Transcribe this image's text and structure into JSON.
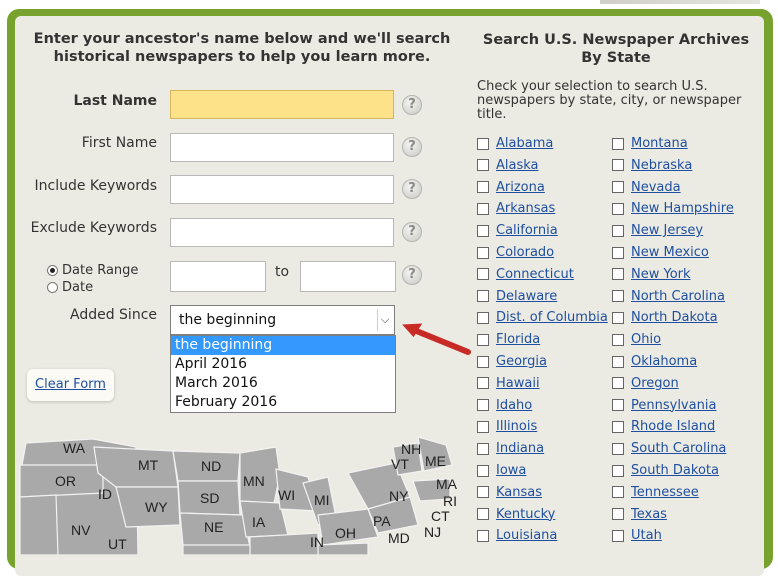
{
  "search_form": {
    "heading": "Enter your ancestor's name below and we'll search historical newspapers to help you learn more.",
    "last_name_label": "Last Name",
    "first_name_label": "First Name",
    "include_keywords_label": "Include Keywords",
    "exclude_keywords_label": "Exclude Keywords",
    "date_range_label": "Date Range",
    "date_label": "Date",
    "to_label": "to",
    "added_since_label": "Added Since",
    "added_since_value": "the beginning",
    "added_since_options": [
      "the beginning",
      "April 2016",
      "March 2016",
      "February 2016"
    ],
    "help_glyph": "?",
    "clear_form": "Clear Form"
  },
  "map": {
    "labels": [
      "WA",
      "MT",
      "ND",
      "MN",
      "NH",
      "VT",
      "ME",
      "OR",
      "ID",
      "SD",
      "WI",
      "MI",
      "NY",
      "MA",
      "WY",
      "RI",
      "NV",
      "NE",
      "IA",
      "PA",
      "CT",
      "OH",
      "NJ",
      "MD",
      "IN",
      "UT"
    ]
  },
  "archives": {
    "heading": "Search U.S. Newspaper Archives By State",
    "description": "Check your selection to search U.S. newspapers by state, city, or newspaper title.",
    "left_states": [
      "Alabama",
      "Alaska",
      "Arizona",
      "Arkansas",
      "California",
      "Colorado",
      "Connecticut",
      "Delaware",
      "Dist. of Columbia",
      "Florida",
      "Georgia",
      "Hawaii",
      "Idaho",
      "Illinois",
      "Indiana",
      "Iowa",
      "Kansas",
      "Kentucky",
      "Louisiana"
    ],
    "right_states": [
      "Montana",
      "Nebraska",
      "Nevada",
      "New Hampshire",
      "New Jersey",
      "New Mexico",
      "New York",
      "North Carolina",
      "North Dakota",
      "Ohio",
      "Oklahoma",
      "Oregon",
      "Pennsylvania",
      "Rhode Island",
      "South Carolina",
      "South Dakota",
      "Tennessee",
      "Texas",
      "Utah"
    ]
  },
  "colors": {
    "frame": "#78a22e",
    "highlight": "#fde28a",
    "link": "#1f4fa0",
    "selected": "#3399ff"
  }
}
